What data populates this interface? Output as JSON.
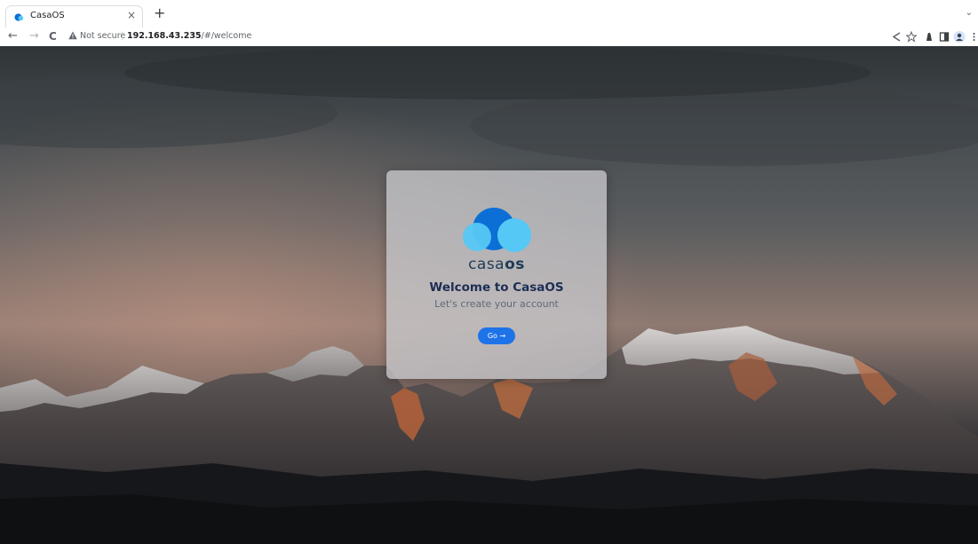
{
  "browser": {
    "tab": {
      "title": "CasaOS",
      "close_glyph": "×",
      "favicon": "casaos-logo-icon"
    },
    "new_tab_glyph": "+",
    "tab_search_glyph": "⌄",
    "toolbar": {
      "back_glyph": "←",
      "forward_glyph": "→",
      "reload_glyph": "C",
      "security_icon": "warning-triangle-icon",
      "security_label": "Not secure",
      "separator": "|",
      "url_host": "192.168.43.235",
      "url_path": "/#/welcome",
      "right_icons": [
        "share-icon",
        "bookmark-star-icon",
        "extension-icon",
        "side-panel-icon",
        "profile-icon",
        "menu-icon"
      ]
    }
  },
  "page": {
    "logo": {
      "word_light": "casa",
      "word_bold": "os",
      "primary_color": "#0b6fd6",
      "secondary_color": "#56c8f5"
    },
    "title": "Welcome to CasaOS",
    "subtitle": "Let's create your account",
    "go_button": "Go →",
    "accent_color": "#1e73e8"
  }
}
